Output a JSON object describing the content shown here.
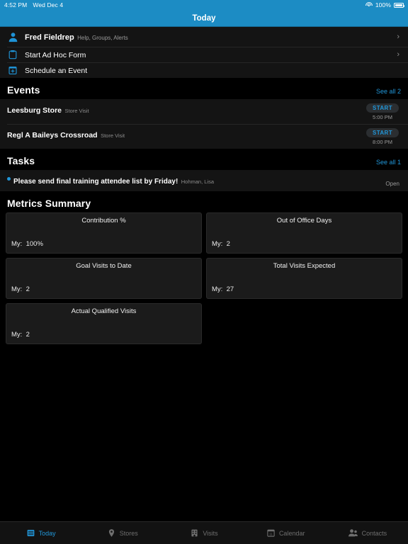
{
  "status_bar": {
    "time": "4:52 PM",
    "date": "Wed Dec 4",
    "battery_percent": "100%",
    "wifi_icon": "wifi-icon",
    "battery_icon": "battery-full-icon"
  },
  "nav": {
    "title": "Today"
  },
  "quick_actions": [
    {
      "icon": "person-icon",
      "title": "Fred Fieldrep",
      "subtitle": "Help, Groups, Alerts",
      "chevron": "›"
    },
    {
      "icon": "clipboard-icon",
      "title": "Start Ad Hoc Form",
      "subtitle": "",
      "chevron": "›"
    },
    {
      "icon": "calendar-plus-icon",
      "title": "Schedule an Event",
      "subtitle": "",
      "chevron": ""
    }
  ],
  "events": {
    "title": "Events",
    "see_all": "See all 2",
    "rows": [
      {
        "name": "Leesburg Store",
        "type": "Store Visit",
        "action": "START",
        "time": "5:00 PM"
      },
      {
        "name": "Regl A Baileys Crossroad",
        "type": "Store Visit",
        "action": "START",
        "time": "8:00 PM"
      }
    ]
  },
  "tasks": {
    "title": "Tasks",
    "see_all": "See all 1",
    "rows": [
      {
        "title": "Please send final training attendee list by Friday!",
        "assignee": "Hohman, Lisa",
        "status": "Open"
      }
    ]
  },
  "metrics": {
    "title": "Metrics Summary",
    "label_prefix": "My:",
    "cards": [
      {
        "title": "Contribution %",
        "label": "My:",
        "value": "100%"
      },
      {
        "title": "Out of Office Days",
        "label": "My:",
        "value": "2"
      },
      {
        "title": "Goal Visits to Date",
        "label": "My:",
        "value": "2"
      },
      {
        "title": "Total Visits Expected",
        "label": "My:",
        "value": "27"
      },
      {
        "title": "Actual Qualified Visits",
        "label": "My:",
        "value": "2"
      }
    ]
  },
  "tabbar": {
    "tabs": [
      {
        "label": "Today",
        "icon": "today-list-icon",
        "active": true
      },
      {
        "label": "Stores",
        "icon": "map-pin-icon",
        "active": false
      },
      {
        "label": "Visits",
        "icon": "building-icon",
        "active": false
      },
      {
        "label": "Calendar",
        "icon": "calendar-icon",
        "active": false
      },
      {
        "label": "Contacts",
        "icon": "people-icon",
        "active": false
      }
    ],
    "calendar_icon_day": "11"
  },
  "colors": {
    "accent": "#2196d8",
    "navbar": "#1c8cc4",
    "background": "#000000",
    "surface": "#141414",
    "card": "#1b1b1b"
  }
}
